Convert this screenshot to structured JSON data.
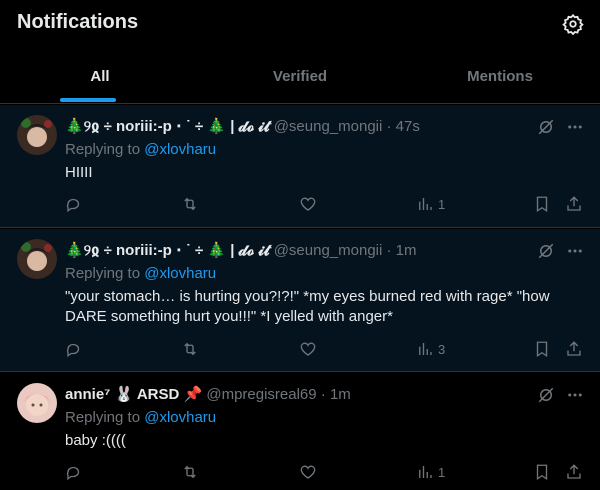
{
  "header": {
    "title": "Notifications"
  },
  "tabs": [
    {
      "label": "All",
      "active": true
    },
    {
      "label": "Verified",
      "active": false
    },
    {
      "label": "Mentions",
      "active": false
    }
  ],
  "tweets": [
    {
      "name": "🎄୨ჲ ÷ noriii:-p ⋅ ˙ ÷ 🎄 | 𝓭𝓸 𝓲𝓽",
      "handle": "@seung_mongii",
      "time": "· 47s",
      "replying_prefix": "Replying to",
      "replying_to": "@xlovharu",
      "text": "HIIII",
      "views": "1"
    },
    {
      "name": "🎄୨ჲ ÷ noriii:-p ⋅ ˙ ÷ 🎄 | 𝓭𝓸 𝓲𝓽",
      "handle": "@seung_mongii",
      "time": "· 1m",
      "replying_prefix": "Replying to",
      "replying_to": "@xlovharu",
      "text": "\"your stomach… is hurting you?!?!\" *my eyes burned red with rage* \"how DARE something hurt you!!!\" *I yelled with anger*",
      "views": "3"
    },
    {
      "name": "annie⁷ 🐰 ARSD 📌",
      "handle": "@mpregisreal69",
      "time": "· 1m",
      "replying_prefix": "Replying to",
      "replying_to": "@xlovharu",
      "text": "baby :((((",
      "views": "1"
    }
  ],
  "icons": {
    "settings": "gear-icon",
    "grok": "grok-icon",
    "more": "more-icon",
    "reply": "reply-icon",
    "retweet": "retweet-icon",
    "like": "heart-icon",
    "views": "views-icon",
    "bookmark": "bookmark-icon",
    "share": "share-icon"
  },
  "colors": {
    "accent": "#1d9bf0",
    "muted": "#71767b",
    "unread_bg": "#05131f",
    "border": "#2f3336"
  }
}
